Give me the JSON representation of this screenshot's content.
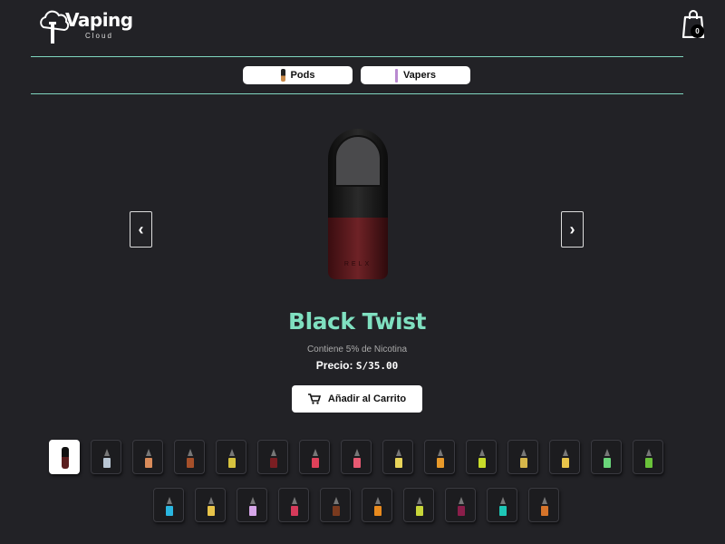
{
  "header": {
    "logo_word": "Vaping",
    "logo_sub": "Cloud",
    "cart_count": "0"
  },
  "categories": [
    {
      "label": "Pods"
    },
    {
      "label": "Vapers"
    }
  ],
  "product": {
    "name": "Black Twist",
    "nicotine": "Contiene 5% de Nicotina",
    "price_label": "Precio:",
    "price_value": "S/35.00",
    "add_to_cart": "Añadir al Carrito",
    "prev_arrow": "‹",
    "next_arrow": "›"
  },
  "flavor_thumbs": {
    "row1_colors": [
      "pod",
      "#b9c6d4",
      "#d98b5a",
      "#a6502a",
      "#d6c23e",
      "#7a1e22",
      "#e0415a",
      "#e85a72",
      "#e8d45a",
      "#e89a2a",
      "#c8dc2a",
      "#d6b64a",
      "#e8c44a",
      "#6ad67a",
      "#6ac23a"
    ],
    "row2_colors": [
      "#2ab6e0",
      "#e8c44a",
      "#d6a6e8",
      "#d63a5a",
      "#7a3a1e",
      "#e88a1e",
      "#c8d63a",
      "#8a1e4a",
      "#1ec6b6",
      "#d6742a"
    ]
  }
}
